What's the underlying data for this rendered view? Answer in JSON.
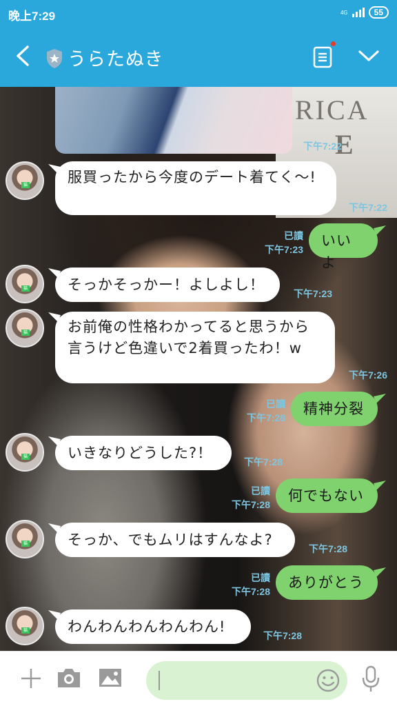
{
  "status_bar": {
    "time": "晚上7:29",
    "network": "4G",
    "battery": "55"
  },
  "header": {
    "contact_name": "うらたぬき"
  },
  "background": {
    "wall_text_1": "RICA",
    "wall_text_2": "E"
  },
  "messages": [
    {
      "side": "left",
      "text": "服買ったから今度のデート着てく〜!",
      "time": "下午7:22"
    },
    {
      "side": "right",
      "text": "いいよ",
      "read": "已讀",
      "time": "下午7:23"
    },
    {
      "side": "left",
      "text": "そっかそっかー！よしよし！",
      "time": "下午7:23"
    },
    {
      "side": "left",
      "text": "お前俺の性格わかってると思うから言うけど色違いで2着買ったわ！w",
      "time": "下午7:26"
    },
    {
      "side": "right",
      "text": "精神分裂",
      "read": "已讀",
      "time": "下午7:28"
    },
    {
      "side": "left",
      "text": "いきなりどうした?！",
      "time": "下午7:28"
    },
    {
      "side": "right",
      "text": "何でもない",
      "read": "已讀",
      "time": "下午7:28"
    },
    {
      "side": "left",
      "text": "そっか、でもムリはすんなよ?",
      "time": "下午7:28"
    },
    {
      "side": "right",
      "text": "ありがとう",
      "read": "已讀",
      "time": "下午7:28"
    },
    {
      "side": "left",
      "text": "わんわんわんわんわん!",
      "time": "下午7:28"
    }
  ],
  "photo_message": {
    "time": "下午7:22"
  },
  "input": {
    "placeholder": "",
    "value": ""
  },
  "icons": {
    "back": "chevron-left-icon",
    "verified": "shield-star-icon",
    "notes": "notes-icon",
    "menu": "chevron-down-icon",
    "add": "plus-icon",
    "camera": "camera-icon",
    "gallery": "image-icon",
    "emoji": "smiley-icon",
    "voice": "microphone-icon"
  },
  "colors": {
    "header": "#2aa8dc",
    "sent_bubble": "#80d26e",
    "received_bubble": "#ffffff",
    "meta_text": "#7ec6e0",
    "input_field": "#d9f2d2"
  }
}
